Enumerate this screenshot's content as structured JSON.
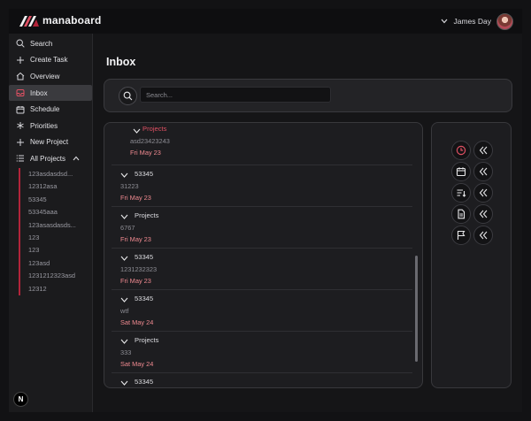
{
  "app": {
    "brand": "manaboard",
    "user_name": "James Day"
  },
  "colors": {
    "accent": "#b3243a",
    "date": "#f08a90",
    "background": "#121214"
  },
  "sidebar": {
    "items": [
      {
        "label": "Search",
        "icon": "search-icon"
      },
      {
        "label": "Create Task",
        "icon": "plus-icon"
      },
      {
        "label": "Overview",
        "icon": "home-icon"
      },
      {
        "label": "Inbox",
        "icon": "inbox-icon",
        "active": true
      },
      {
        "label": "Schedule",
        "icon": "calendar-icon"
      },
      {
        "label": "Priorities",
        "icon": "priority-icon"
      },
      {
        "label": "New Project",
        "icon": "plus-icon"
      },
      {
        "label": "All Projects",
        "icon": "list-icon"
      }
    ],
    "projects": [
      "123asdasdsd...",
      "12312asa",
      "53345",
      "53345aaa",
      "123asasdasds...",
      "123",
      "123",
      "123asd",
      "1231212323asd",
      "12312"
    ],
    "badge": "N"
  },
  "main": {
    "title": "Inbox",
    "search": {
      "placeholder": "Search...",
      "value": ""
    },
    "tasks": [
      {
        "title": "Projects",
        "desc": "asd23423243",
        "date": "Fri May 23"
      },
      {
        "title": "53345",
        "desc": "31223",
        "date": "Fri May 23"
      },
      {
        "title": "Projects",
        "desc": "6767",
        "date": "Fri May 23"
      },
      {
        "title": "53345",
        "desc": "1231232323",
        "date": "Fri May 23"
      },
      {
        "title": "53345",
        "desc": "wtf",
        "date": "Sat May 24"
      },
      {
        "title": "Projects",
        "desc": "333",
        "date": "Sat May 24"
      },
      {
        "title": "53345",
        "desc": "",
        "date": ""
      }
    ],
    "tools": [
      {
        "icon": "clock-icon",
        "collapse_icon": "double-chevron-left-icon"
      },
      {
        "icon": "calendar-icon",
        "collapse_icon": "double-chevron-left-icon"
      },
      {
        "icon": "sort-icon",
        "collapse_icon": "double-chevron-left-icon"
      },
      {
        "icon": "document-icon",
        "collapse_icon": "double-chevron-left-icon"
      },
      {
        "icon": "flag-icon",
        "collapse_icon": "double-chevron-left-icon"
      }
    ]
  }
}
